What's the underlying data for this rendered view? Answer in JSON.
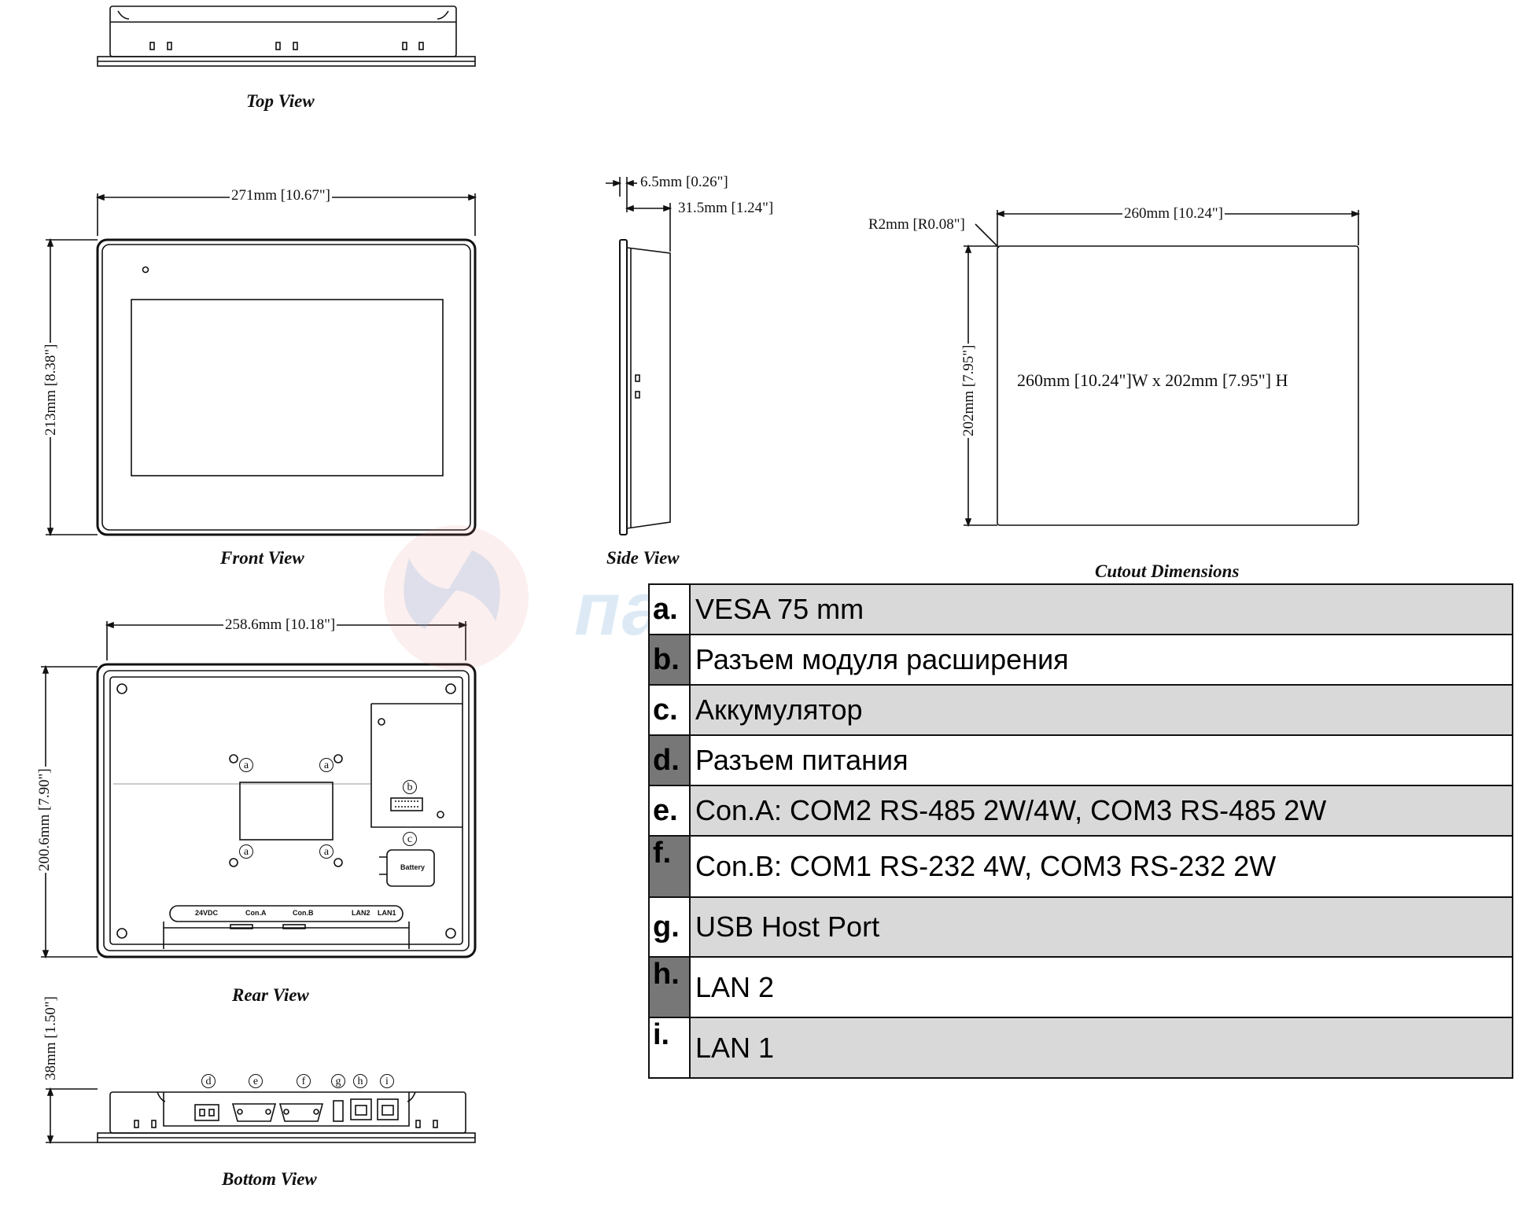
{
  "views": {
    "top": "Top View",
    "front": "Front View",
    "side": "Side View",
    "cutout": "Cutout Dimensions",
    "rear": "Rear View",
    "bottom": "Bottom View"
  },
  "dimensions": {
    "front_width": "271mm [10.67\"]",
    "front_height": "213mm [8.38\"]",
    "side_bezel": "6.5mm [0.26\"]",
    "side_depth": "31.5mm [1.24\"]",
    "cutout_radius": "R2mm [R0.08\"]",
    "cutout_width": "260mm [10.24\"]",
    "cutout_height": "202mm [7.95\"]",
    "cutout_size": "260mm [10.24\"]W x 202mm [7.95\"] H",
    "rear_width": "258.6mm [10.18\"]",
    "rear_height": "200.6mm [7.90\"]",
    "bottom_height": "38mm [1.50\"]"
  },
  "rear_labels": {
    "battery": "Battery",
    "power": "24VDC",
    "con_a": "Con.A",
    "con_b": "Con.B",
    "lan2": "LAN2",
    "lan1": "LAN1"
  },
  "markers": [
    "a",
    "b",
    "c",
    "d",
    "e",
    "f",
    "g",
    "h",
    "i"
  ],
  "watermark": "пауэр климат",
  "legend": [
    {
      "letter": "a.",
      "text": "VESA 75 mm"
    },
    {
      "letter": "b.",
      "text": "Разъем модуля расширения"
    },
    {
      "letter": "c.",
      "text": "Аккумулятор"
    },
    {
      "letter": "d.",
      "text": "Разъем питания"
    },
    {
      "letter": "e.",
      "text": "Con.A: COM2 RS-485 2W/4W, COM3 RS-485 2W"
    },
    {
      "letter": "f.",
      "text": "Con.B: COM1 RS-232 4W, COM3 RS-232 2W"
    },
    {
      "letter": "g.",
      "text": "USB Host Port"
    },
    {
      "letter": "h.",
      "text": "LAN 2"
    },
    {
      "letter": "i.",
      "text": "LAN 1"
    }
  ]
}
